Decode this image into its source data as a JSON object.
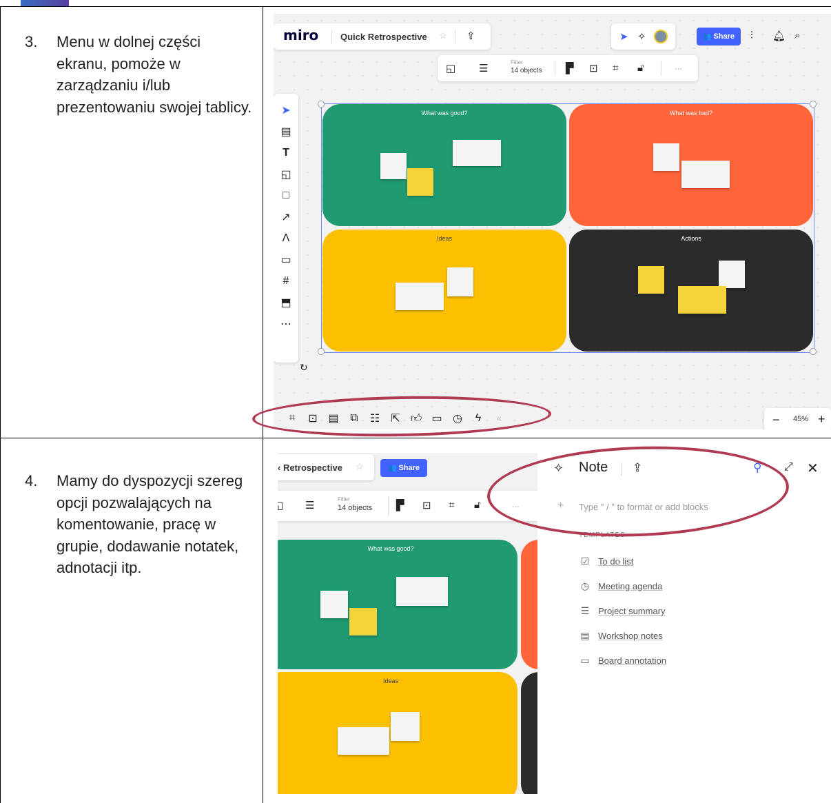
{
  "steps": [
    {
      "number": "3.",
      "text": "Menu w dolnej części ekranu, pomoże w zarządzaniu i/lub prezentowaniu swojej tablicy."
    },
    {
      "number": "4.",
      "text": "Mamy do dyspozycji szereg opcji pozwalających na komentowanie, pracę w grupie, dodawanie notatek, adnotacji itp."
    }
  ],
  "shot1": {
    "logo": "miro",
    "board_title": "Quick Retrospective",
    "share_label": "Share",
    "filter_label": "Filter",
    "filter_value": "14 objects",
    "more_label": "...",
    "frames": [
      {
        "title": "What was good?",
        "color": "#1f9a73"
      },
      {
        "title": "What was bad?",
        "color": "#ff643a"
      },
      {
        "title": "Ideas",
        "color": "#fcc000"
      },
      {
        "title": "Actions",
        "color": "#2b2b2b"
      }
    ],
    "zoom": "45%",
    "zoom_minus": "−",
    "zoom_plus": "+",
    "collapse": "«"
  },
  "shot2": {
    "board_title": "‹ Retrospective",
    "share_label": "Share",
    "filter_label": "Filter",
    "filter_value": "14 objects",
    "more_label": "...",
    "frame_good": "What was good?",
    "frame_ideas": "Ideas"
  },
  "note_panel": {
    "title": "Note",
    "placeholder": "Type \" / \" to format or add blocks",
    "templates_heading": "TEMPLATES",
    "templates": [
      {
        "label": "To do list",
        "icon": "checkbox-icon"
      },
      {
        "label": "Meeting agenda",
        "icon": "clock-icon"
      },
      {
        "label": "Project summary",
        "icon": "list-icon"
      },
      {
        "label": "Workshop notes",
        "icon": "notes-icon"
      },
      {
        "label": "Board annotation",
        "icon": "annotation-icon"
      }
    ]
  },
  "colors": {
    "highlight_ellipse": "#b03a52",
    "share_blue": "#4262ff"
  }
}
